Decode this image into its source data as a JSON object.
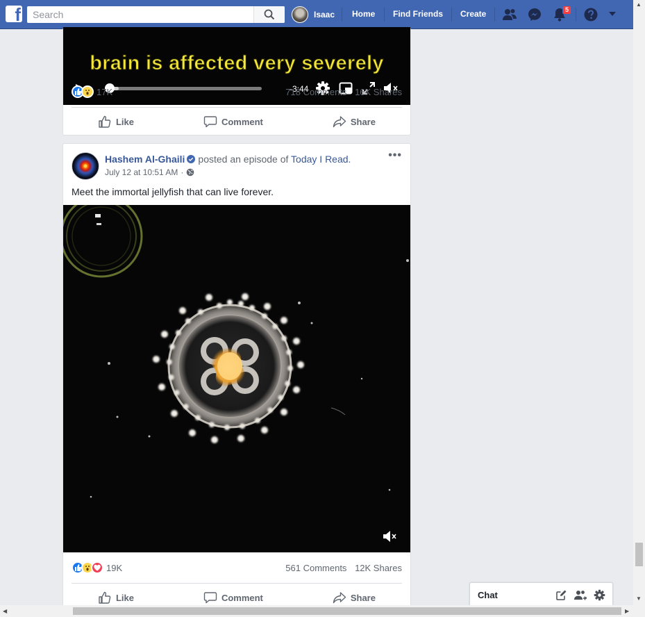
{
  "nav": {
    "search_placeholder": "Search",
    "user_name": "Isaac",
    "home": "Home",
    "find_friends": "Find Friends",
    "create": "Create",
    "notification_count": "5"
  },
  "post1": {
    "video_caption": "brain is affected very severely",
    "time_remaining": "-3:44",
    "progress": 0.08,
    "reaction_count": "17K",
    "comments": "718 Comments",
    "shares": "16K Shares"
  },
  "post2": {
    "author": "Hashem Al-Ghaili",
    "action": "posted an episode of",
    "show": "Today I Read.",
    "timestamp": "July 12 at 10:51 AM",
    "text": "Meet the immortal jellyfish that can live forever.",
    "reaction_count": "19K",
    "comments": "561 Comments",
    "shares": "12K Shares"
  },
  "actions": {
    "like": "Like",
    "comment": "Comment",
    "share": "Share"
  },
  "chat": {
    "label": "Chat"
  },
  "colors": {
    "brand": "#4267b2",
    "link": "#385898",
    "background": "#e9ebee",
    "notification": "#fa3e3e"
  }
}
